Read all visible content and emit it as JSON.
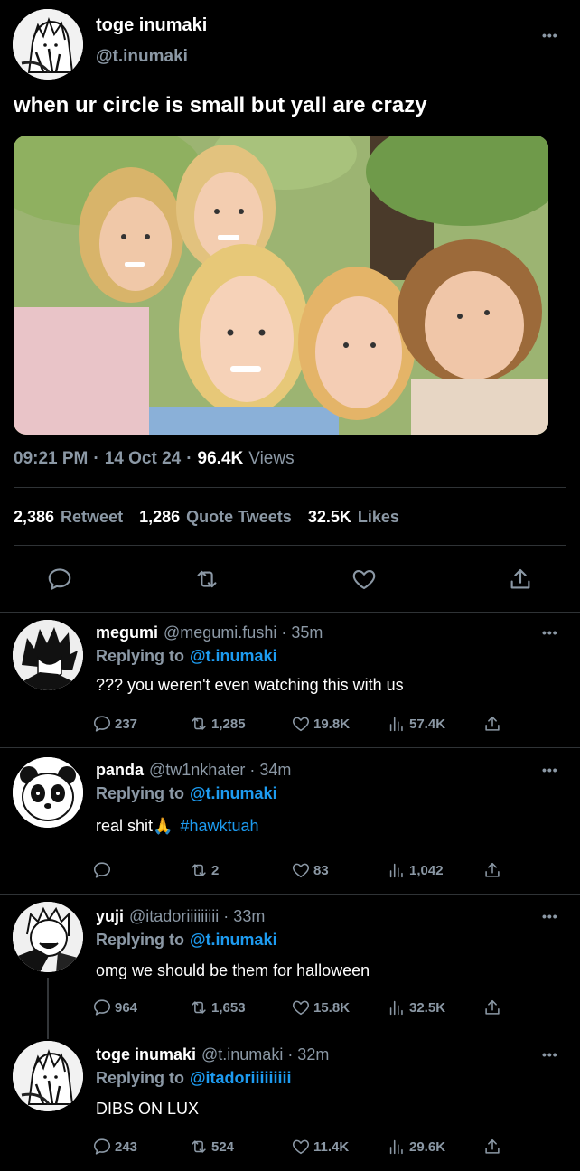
{
  "main_tweet": {
    "display_name": "toge inumaki",
    "handle": "@t.inumaki",
    "text": "when ur circle is small but yall are crazy",
    "time": "09:21 PM",
    "date": "14 Oct 24",
    "views_count": "96.4K",
    "views_label": "Views",
    "retweets_count": "2,386",
    "retweets_label": "Retweet",
    "quotes_count": "1,286",
    "quotes_label": "Quote Tweets",
    "likes_count": "32.5K",
    "likes_label": "Likes"
  },
  "replying_label": "Replying to",
  "more_label": "•••",
  "replies": [
    {
      "display_name": "megumi",
      "handle": "@megumi.fushi · 35m",
      "replying_to": "@t.inumaki",
      "text": "??? you weren't even watching this with us",
      "replies": "237",
      "retweets": "1,285",
      "likes": "19.8K",
      "views": "57.4K"
    },
    {
      "display_name": "panda",
      "handle": "@tw1nkhater · 34m",
      "replying_to": "@t.inumaki",
      "text": "real shit🙏",
      "hashtag": "#hawktuah",
      "replies": "",
      "retweets": "2",
      "likes": "83",
      "views": "1,042"
    },
    {
      "display_name": "yuji",
      "handle": "@itadoriiiiiiiii · 33m",
      "replying_to": "@t.inumaki",
      "text": "omg we should be them for halloween",
      "replies": "964",
      "retweets": "1,653",
      "likes": "15.8K",
      "views": "32.5K"
    },
    {
      "display_name": "toge inumaki",
      "handle": "@t.inumaki · 32m",
      "replying_to": "@itadoriiiiiiiii",
      "text": "DIBS ON LUX",
      "replies": "243",
      "retweets": "524",
      "likes": "11.4K",
      "views": "29.6K"
    }
  ],
  "icons": {
    "reply": "reply-icon",
    "retweet": "retweet-icon",
    "like": "heart-icon",
    "views": "views-icon",
    "share": "share-icon"
  },
  "colors": {
    "background": "#000000",
    "link_blue": "#1d9bf0",
    "muted": "#8b98a5",
    "divider": "#2f3336"
  }
}
